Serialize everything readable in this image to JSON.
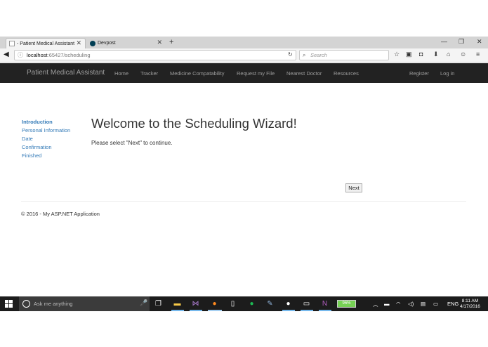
{
  "browser": {
    "tabs": [
      {
        "title": "- Patient Medical Assistant",
        "active": true
      },
      {
        "title": "Devpost",
        "active": false
      }
    ],
    "url_host": "localhost",
    "url_path": ":65427/scheduling",
    "search_placeholder": "Search"
  },
  "site": {
    "brand": "Patient Medical Assistant",
    "nav": [
      "Home",
      "Tracker",
      "Medicine Compatability",
      "Request my File",
      "Nearest Doctor",
      "Resources"
    ],
    "nav_right": [
      "Register",
      "Log in"
    ]
  },
  "wizard": {
    "steps": [
      "Introduction",
      "Personal Information",
      "Date",
      "Confirmation",
      "Finished"
    ],
    "active_step": "Introduction",
    "title": "Welcome to the Scheduling Wizard!",
    "text": "Please select \"Next\" to continue.",
    "next_label": "Next"
  },
  "footer": "© 2016 - My ASP.NET Application",
  "taskbar": {
    "search_placeholder": "Ask me anything",
    "battery": "96%",
    "language": "ENG",
    "time": "8:11 AM",
    "date": "4/17/2016"
  },
  "colors": {
    "navbar": "#222222",
    "link": "#337ab7",
    "taskbar": "#1c1c1c"
  }
}
